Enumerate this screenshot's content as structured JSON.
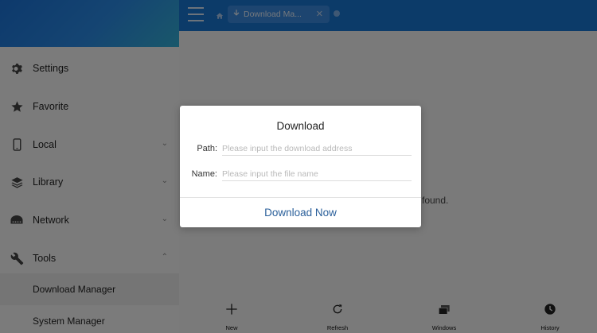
{
  "sidebar": {
    "items": [
      {
        "label": "Settings",
        "icon": "gear-icon"
      },
      {
        "label": "Favorite",
        "icon": "star-icon"
      },
      {
        "label": "Local",
        "icon": "phone-icon"
      },
      {
        "label": "Library",
        "icon": "layers-icon"
      },
      {
        "label": "Network",
        "icon": "network-icon"
      },
      {
        "label": "Tools",
        "icon": "wrench-icon"
      }
    ],
    "subitems": [
      {
        "label": "Download Manager"
      },
      {
        "label": "System Manager"
      }
    ]
  },
  "topbar": {
    "tab_label": "Download Ma...",
    "accent": "#1976d2"
  },
  "main": {
    "empty_text": "found."
  },
  "toolbar": {
    "new_label": "New",
    "refresh_label": "Refresh",
    "windows_label": "Windows",
    "history_label": "History"
  },
  "dialog": {
    "title": "Download",
    "path_label": "Path:",
    "path_placeholder": "Please input the download address",
    "path_value": "",
    "name_label": "Name:",
    "name_placeholder": "Please input the file name",
    "name_value": "",
    "action_label": "Download Now"
  }
}
